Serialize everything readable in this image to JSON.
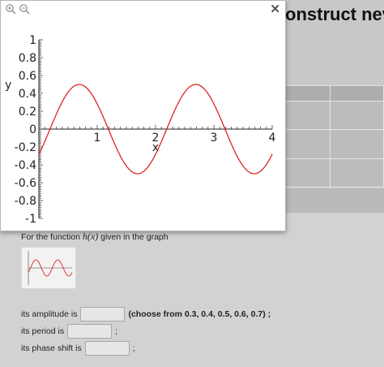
{
  "background": {
    "heading": "onstruct nev"
  },
  "popup": {
    "zoom_in_icon": "zoom-in-icon",
    "zoom_out_icon": "zoom-out-icon",
    "close_label": "✕",
    "chart_data": {
      "type": "line",
      "function": "y = 0.5*sin(pi*x - 0.6)",
      "series": [
        {
          "color": "#e02424",
          "x_range": [
            0,
            4
          ],
          "amplitude": 0.5,
          "period": 2,
          "phase_shift": 0.6
        }
      ],
      "xlabel": "x",
      "ylabel": "y",
      "xlim": [
        0,
        4
      ],
      "ylim": [
        -1,
        1
      ],
      "x_ticks": [
        "1",
        "2",
        "3",
        "4"
      ],
      "y_ticks": [
        "1",
        "0.8",
        "0.6",
        "0.4",
        "0.2",
        "0",
        "-0.2",
        "-0.4",
        "-0.6",
        "-0.8",
        "-1"
      ],
      "grid": false
    }
  },
  "problem": {
    "prefix": "For the function ",
    "func": "h(x)",
    "suffix": " given in the graph",
    "amplitude_label": "its amplitude is",
    "amplitude_value": "",
    "amplitude_hint": "(choose from 0.3, 0.4, 0.5, 0.6, 0.7) ;",
    "period_label": "its period is",
    "period_value": "",
    "period_suffix": ";",
    "phase_label": "its phase shift is",
    "phase_value": "",
    "phase_suffix": ";"
  }
}
